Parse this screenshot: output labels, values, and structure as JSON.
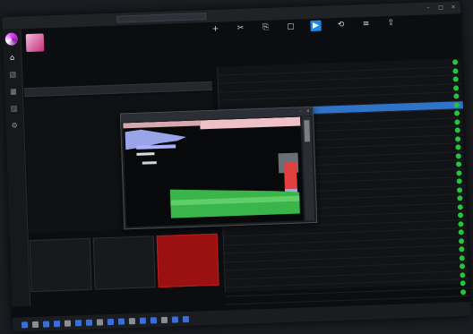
{
  "window": {
    "title": "",
    "search_placeholder": "",
    "controls": [
      "–",
      "□",
      "×"
    ]
  },
  "leftnav": {
    "items": [
      {
        "icon": "home-icon",
        "glyph": "⌂"
      },
      {
        "icon": "library-icon",
        "glyph": "▤"
      },
      {
        "icon": "calendar-icon",
        "glyph": "▦"
      },
      {
        "icon": "chart-icon",
        "glyph": "▥"
      },
      {
        "icon": "settings-icon",
        "glyph": "⚙"
      }
    ]
  },
  "track": {
    "title": "",
    "subtitle": ""
  },
  "ribbon": [
    {
      "icon": "plus-icon",
      "glyph": "+",
      "label": ""
    },
    {
      "icon": "cut-icon",
      "glyph": "✂",
      "label": ""
    },
    {
      "icon": "copy-icon",
      "glyph": "⎘",
      "label": ""
    },
    {
      "icon": "paste-icon",
      "glyph": "▢",
      "label": ""
    },
    {
      "icon": "play-icon",
      "glyph": "▶",
      "label": "",
      "active": true
    },
    {
      "icon": "loop-icon",
      "glyph": "⟲",
      "label": ""
    },
    {
      "icon": "list-icon",
      "glyph": "≡",
      "label": ""
    },
    {
      "icon": "export-icon",
      "glyph": "⇪",
      "label": ""
    }
  ],
  "playlist": {
    "rows": [
      {
        "num": "",
        "title": "",
        "artist": "",
        "time": "",
        "selected": false
      },
      {
        "num": "",
        "title": "",
        "artist": "",
        "time": "",
        "selected": false
      },
      {
        "num": "",
        "title": "",
        "artist": "",
        "time": "",
        "selected": false
      },
      {
        "num": "",
        "title": "",
        "artist": "",
        "time": "",
        "selected": false
      },
      {
        "num": "",
        "title": "",
        "artist": "",
        "time": "",
        "selected": false
      },
      {
        "num": "",
        "title": "",
        "artist": "",
        "time": "",
        "selected": true
      },
      {
        "num": "",
        "title": "",
        "artist": "",
        "time": "",
        "selected": false
      },
      {
        "num": "",
        "title": "",
        "artist": "",
        "time": "",
        "selected": false
      },
      {
        "num": "",
        "title": "",
        "artist": "",
        "time": "",
        "selected": false
      },
      {
        "num": "",
        "title": "",
        "artist": "",
        "time": "",
        "selected": false
      },
      {
        "num": "",
        "title": "",
        "artist": "",
        "time": "",
        "selected": false
      },
      {
        "num": "",
        "title": "",
        "artist": "",
        "time": "",
        "selected": false
      },
      {
        "num": "",
        "title": "",
        "artist": "",
        "time": "",
        "selected": false
      },
      {
        "num": "",
        "title": "",
        "artist": "",
        "time": "",
        "selected": false
      },
      {
        "num": "",
        "title": "",
        "artist": "",
        "time": "",
        "selected": false
      },
      {
        "num": "",
        "title": "",
        "artist": "",
        "time": "",
        "selected": false
      },
      {
        "num": "",
        "title": "",
        "artist": "",
        "time": "",
        "selected": false
      },
      {
        "num": "",
        "title": "",
        "artist": "",
        "time": "",
        "selected": false
      },
      {
        "num": "",
        "title": "",
        "artist": "",
        "time": "",
        "selected": false
      },
      {
        "num": "",
        "title": "",
        "artist": "",
        "time": "",
        "selected": false
      },
      {
        "num": "",
        "title": "",
        "artist": "",
        "time": "",
        "selected": false
      },
      {
        "num": "",
        "title": "",
        "artist": "",
        "time": "",
        "selected": false
      },
      {
        "num": "",
        "title": "",
        "artist": "",
        "time": "",
        "selected": false
      },
      {
        "num": "",
        "title": "",
        "artist": "",
        "time": "",
        "selected": false
      },
      {
        "num": "",
        "title": "",
        "artist": "",
        "time": "",
        "selected": false
      },
      {
        "num": "",
        "title": "",
        "artist": "",
        "time": "",
        "selected": false
      },
      {
        "num": "",
        "title": "",
        "artist": "",
        "time": "",
        "selected": false
      },
      {
        "num": "",
        "title": "",
        "artist": "",
        "time": "",
        "selected": false
      }
    ]
  },
  "pads": [
    {
      "label": "",
      "red": false
    },
    {
      "label": "",
      "red": false
    },
    {
      "label": "",
      "red": true
    }
  ],
  "editor": {
    "title": ""
  },
  "taskbar": {
    "clock": ""
  },
  "colors": {
    "accent": "#2f74c8",
    "status_ok": "#25c43a",
    "alert": "#9b1111"
  }
}
